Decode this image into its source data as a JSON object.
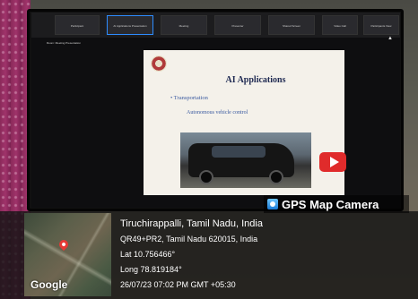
{
  "meeting": {
    "tiles": [
      "Participant",
      "AI Applications Presentation",
      "Meeting",
      "Presenter",
      "Shared Screen",
      "Video Call",
      "Participants View"
    ],
    "room_name": "Room: Meeting Presentation"
  },
  "slide": {
    "title": "AI Applications",
    "bullet": "• Transportation",
    "sub": "Autonomous vehicle control"
  },
  "gps": {
    "app_name": "GPS Map Camera",
    "city": "Tiruchirappalli, Tamil Nadu, India",
    "plus_code": "QR49+PR2, Tamil Nadu 620015, India",
    "lat": "Lat 10.756466°",
    "long": "Long 78.819184°",
    "timestamp": "26/07/23 07:02 PM GMT +05:30",
    "map_provider": "Google"
  },
  "colors": {
    "slide_title": "#1f2a52",
    "slide_text": "#3a5aa0",
    "pin": "#e53935",
    "play_button": "#e02b2b"
  }
}
